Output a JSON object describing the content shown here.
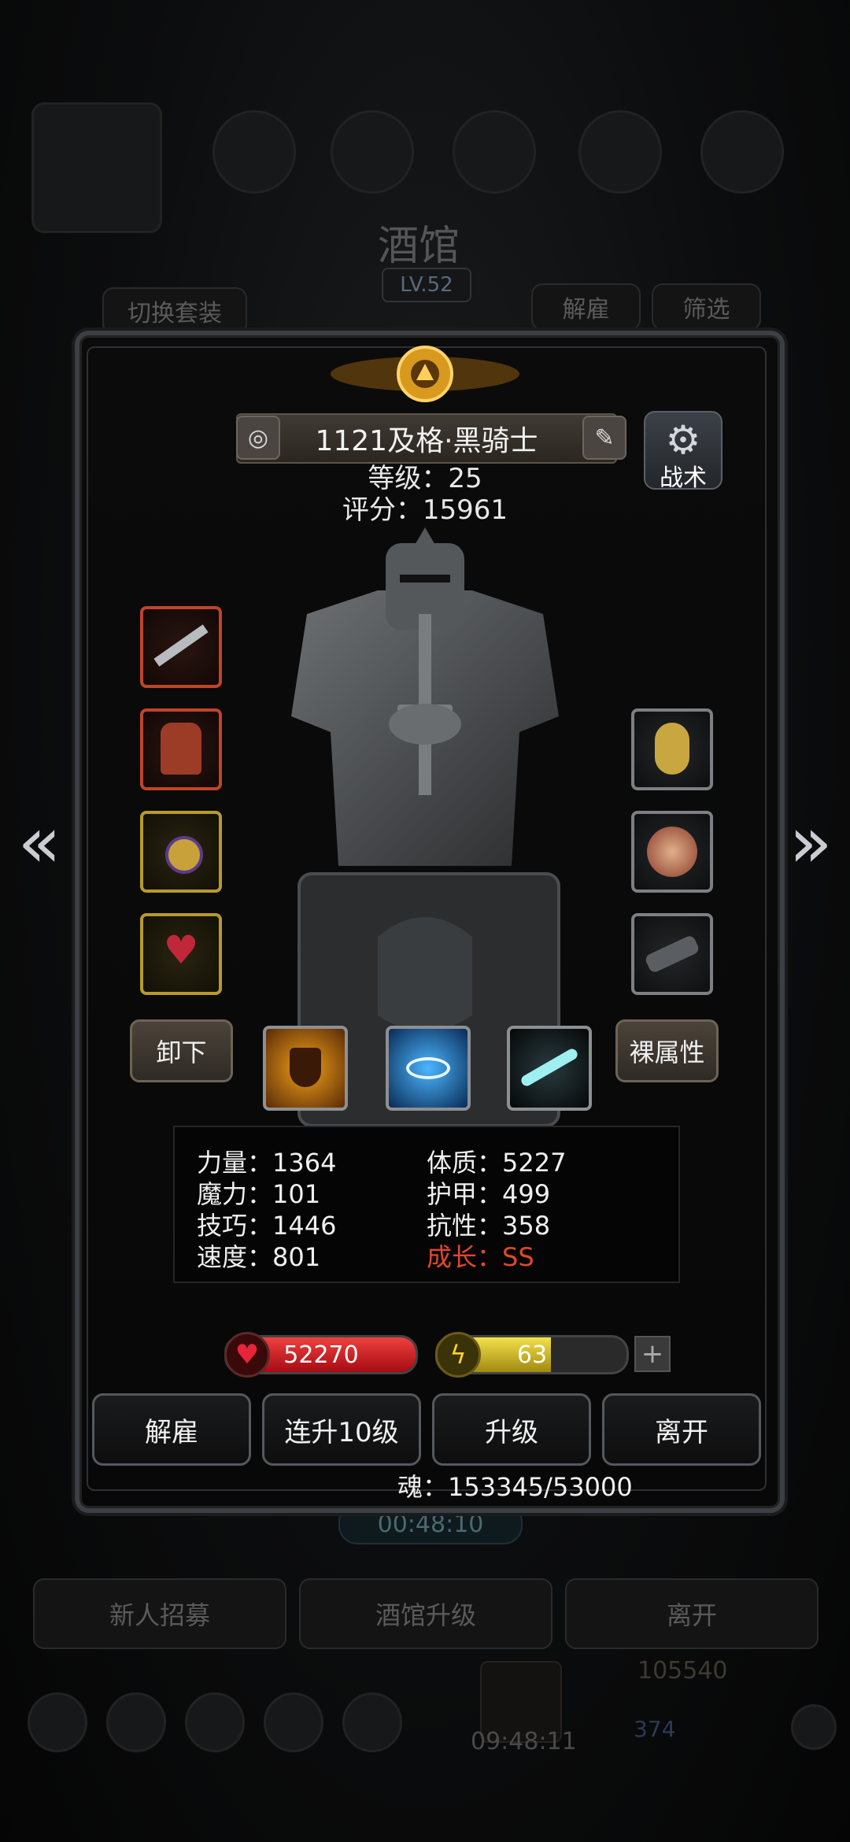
{
  "background": {
    "title": "酒馆",
    "level": "LV.52",
    "switch_outfit": "切换套装",
    "dismiss": "解雇",
    "filter": "筛选",
    "timer": "00:48:10",
    "recruit": "新人招募",
    "tavern_upgrade": "酒馆升级",
    "leave": "离开",
    "gold": "105540",
    "gems": "374",
    "clock": "09:48:11"
  },
  "hero": {
    "name": "1121及格·黑骑士",
    "level_text": "等级：25",
    "score_text": "评分：15961",
    "tactics": "战术"
  },
  "buttons": {
    "unequip": "卸下",
    "base_attr": "裸属性"
  },
  "stats": {
    "strength": "力量：1364",
    "magic": "魔力：101",
    "skill": "技巧：1446",
    "speed": "速度：801",
    "constitution": "体质：5227",
    "armor": "护甲：499",
    "resist": "抗性：358",
    "growth_label": "成长：",
    "growth_value": "SS"
  },
  "bars": {
    "hp": "52270",
    "energy": "63",
    "energy_level": 0.6,
    "plus": "+"
  },
  "actions": {
    "dismiss": "解雇",
    "upgrade10": "连升10级",
    "upgrade": "升级",
    "leave": "离开"
  },
  "soul_text": "魂：153345/53000",
  "colors": {
    "growth": "#e0472e",
    "hp_bar": "#c8141e",
    "energy_bar": "#d6c21a",
    "panel_border": "#3c3f43"
  },
  "icons": {
    "prev": "chevron-left-icon",
    "next": "chevron-right-icon"
  }
}
